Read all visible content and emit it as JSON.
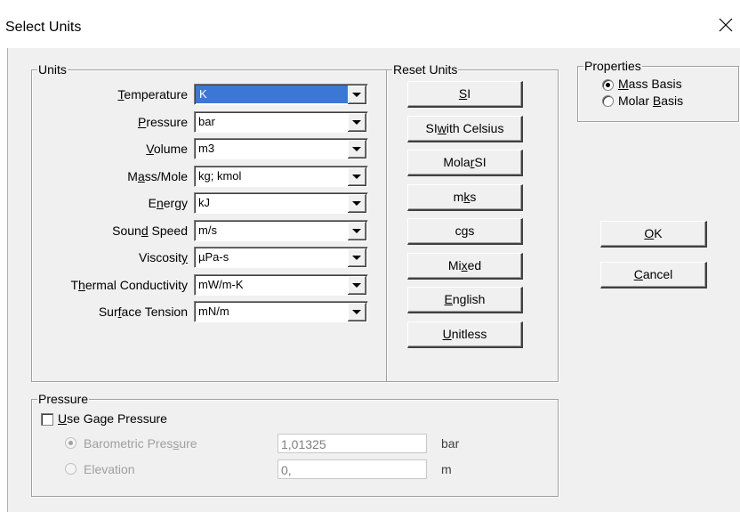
{
  "window": {
    "title": "Select Units",
    "close_icon": "close-icon"
  },
  "units_group": {
    "legend": "Units",
    "rows": [
      {
        "label_pre": "",
        "label_key": "T",
        "label_post": "emperature",
        "value": "K",
        "selected": true
      },
      {
        "label_pre": "",
        "label_key": "P",
        "label_post": "ressure",
        "value": "bar"
      },
      {
        "label_pre": "",
        "label_key": "V",
        "label_post": "olume",
        "value": "m3"
      },
      {
        "label_pre": "M",
        "label_key": "a",
        "label_post": "ss/Mole",
        "value": "kg; kmol"
      },
      {
        "label_pre": "E",
        "label_key": "n",
        "label_post": "ergy",
        "value": "kJ"
      },
      {
        "label_pre": "Soun",
        "label_key": "d",
        "label_post": " Speed",
        "value": "m/s"
      },
      {
        "label_pre": "Viscosit",
        "label_key": "y",
        "label_post": "",
        "value": "µPa-s"
      },
      {
        "label_pre": "T",
        "label_key": "h",
        "label_post": "ermal Conductivity",
        "value": "mW/m-K"
      },
      {
        "label_pre": "Sur",
        "label_key": "f",
        "label_post": "ace Tension",
        "value": "mN/m"
      }
    ]
  },
  "reset_group": {
    "legend": "Reset Units",
    "buttons": [
      {
        "pre": "",
        "key": "S",
        "post": "I"
      },
      {
        "pre": "SI ",
        "key": "w",
        "post": "ith Celsius"
      },
      {
        "pre": "Mola",
        "key": "r",
        "post": " SI"
      },
      {
        "pre": "m",
        "key": "k",
        "post": "s"
      },
      {
        "pre": "c",
        "key": "g",
        "post": "s"
      },
      {
        "pre": "Mi",
        "key": "x",
        "post": "ed"
      },
      {
        "pre": "",
        "key": "E",
        "post": "nglish"
      },
      {
        "pre": "",
        "key": "U",
        "post": "nitless"
      }
    ]
  },
  "properties_group": {
    "legend": "Properties",
    "mass": {
      "pre": "",
      "key": "M",
      "post": "ass Basis",
      "checked": true
    },
    "molar": {
      "pre": "Molar ",
      "key": "B",
      "post": "asis",
      "checked": false
    }
  },
  "dialog_buttons": {
    "ok": {
      "key": "O",
      "post": "K"
    },
    "cancel": {
      "key": "C",
      "post": "ancel"
    }
  },
  "pressure_group": {
    "legend": "Pressure",
    "gage": {
      "key": "U",
      "post": "se Gage Pressure",
      "checked": false
    },
    "barometric": {
      "pre": "Barometric Pres",
      "key": "s",
      "post": "ure",
      "value": "1,01325",
      "unit": "bar"
    },
    "elevation": {
      "label": "Elevation",
      "value": "0,",
      "unit": "m"
    }
  }
}
